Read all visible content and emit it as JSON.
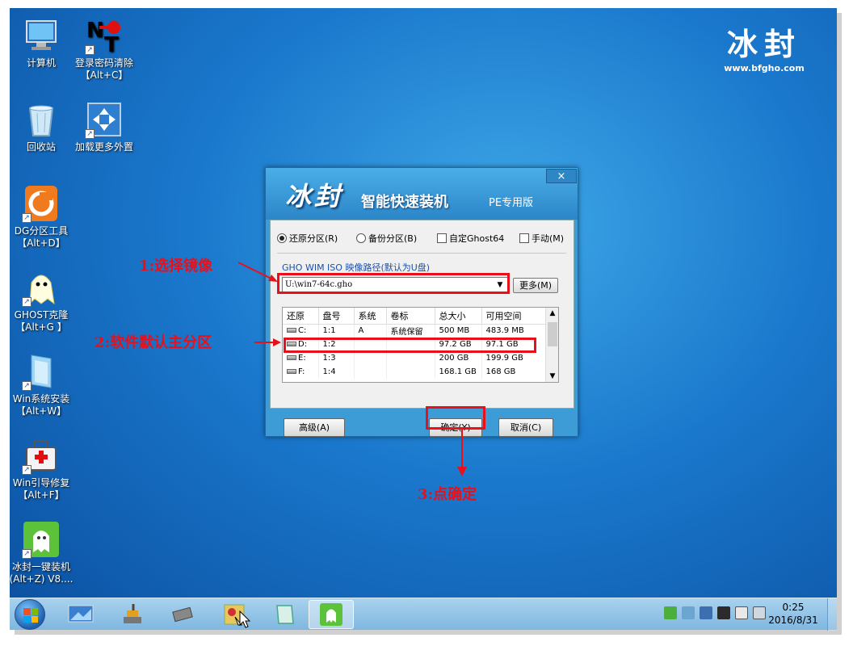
{
  "brand": {
    "title": "冰封",
    "url": "www.bfgho.com"
  },
  "desktop_icons": [
    {
      "label": "计算机",
      "icon": "computer-icon"
    },
    {
      "label": "登录密码清除\n【Alt+C】",
      "icon": "password-clear-icon"
    },
    {
      "label": "回收站",
      "icon": "recycle-bin-icon"
    },
    {
      "label": "加载更多外置",
      "icon": "load-external-icon"
    },
    {
      "label": "DG分区工具\n【Alt+D】",
      "icon": "diskgenius-icon"
    },
    {
      "label": "GHOST克隆\n【Alt+G 】",
      "icon": "ghost-icon"
    },
    {
      "label": "Win系统安装\n【Alt+W】",
      "icon": "windows-install-icon"
    },
    {
      "label": "Win引导修复\n【Alt+F】",
      "icon": "boot-repair-icon"
    },
    {
      "label": "冰封一键装机\n(Alt+Z) V8....",
      "icon": "bingfeng-installer-icon"
    }
  ],
  "dialog": {
    "title_big": "冰封",
    "title_sub": "智能快速装机",
    "title_pe": "PE专用版",
    "close": "×",
    "options": [
      {
        "label": "还原分区(R)",
        "type": "radio",
        "checked": true
      },
      {
        "label": "备份分区(B)",
        "type": "radio",
        "checked": false
      },
      {
        "label": "自定Ghost64",
        "type": "checkbox",
        "checked": false
      },
      {
        "label": "手动(M)",
        "type": "checkbox",
        "checked": false
      }
    ],
    "path_label": "GHO WIM ISO 映像路径(默认为U盘)",
    "path_value": "U:\\win7-64c.gho",
    "more_button": "更多(M)",
    "table": {
      "headers": [
        "还原",
        "盘号",
        "系统",
        "卷标",
        "总大小",
        "可用空间"
      ],
      "rows": [
        [
          "C:",
          "1:1",
          "A",
          "系统保留",
          "500 MB",
          "483.9 MB"
        ],
        [
          "D:",
          "1:2",
          "",
          "",
          "97.2 GB",
          "97.1 GB"
        ],
        [
          "E:",
          "1:3",
          "",
          "",
          "200 GB",
          "199.9 GB"
        ],
        [
          "F:",
          "1:4",
          "",
          "",
          "168.1 GB",
          "168 GB"
        ]
      ]
    },
    "buttons": {
      "advanced": "高级(A)",
      "ok": "确定(Y)",
      "cancel": "取消(C)"
    }
  },
  "annotations": {
    "step1": "1:选择镜像",
    "step2": "2:软件默认主分区",
    "step3": "3:点确定",
    "color": "#e8101a"
  },
  "taskbar": {
    "items": [
      "screen-icon",
      "brush-icon",
      "chip-icon",
      "tools-icon",
      "notepad-icon",
      "bingfeng-installer-icon"
    ],
    "clock_time": "0:25",
    "clock_date": "2016/8/31"
  }
}
